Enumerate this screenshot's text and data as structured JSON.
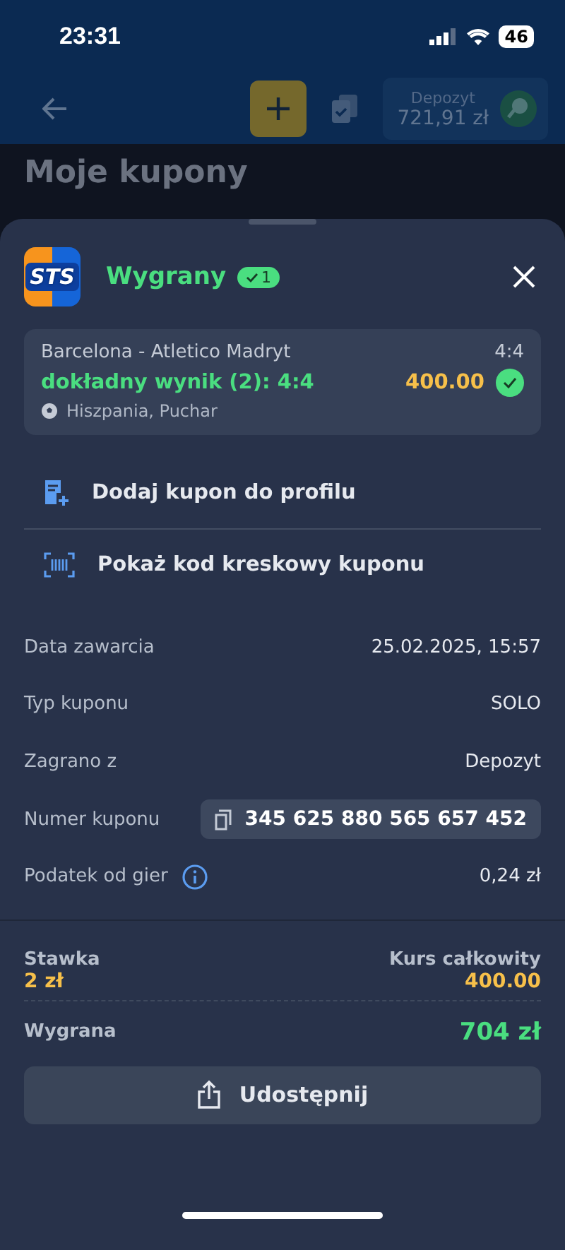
{
  "status_bar": {
    "time": "23:31",
    "battery": "46"
  },
  "header": {
    "balance_label": "Depozyt",
    "balance": "721,91 zł"
  },
  "page_title": "Moje kupony",
  "sheet": {
    "logo": "STS",
    "status": "Wygrany",
    "won_count": "1",
    "bet": {
      "match": "Barcelona - Atletico Madryt",
      "score": "4:4",
      "selection": "dokładny wynik (2): 4:4",
      "odds": "400.00",
      "won": true,
      "league": "Hiszpania, Puchar"
    },
    "actions": [
      {
        "kind": "add",
        "label": "Dodaj kupon do profilu"
      },
      {
        "kind": "barcode",
        "label": "Pokaż kod kreskowy kuponu"
      }
    ],
    "details": [
      {
        "kind": "text",
        "label": "Data zawarcia",
        "value": "25.02.2025, 15:57"
      },
      {
        "kind": "text",
        "label": "Typ kuponu",
        "value": "SOLO"
      },
      {
        "kind": "text",
        "label": "Zagrano z",
        "value": "Depozyt"
      },
      {
        "kind": "copy",
        "label": "Numer kuponu",
        "value": "345 625 880 565 657 452"
      },
      {
        "kind": "info",
        "label": "Podatek od gier",
        "value": "0,24 zł"
      }
    ],
    "summary": {
      "stake_label": "Stawka",
      "stake": "2 zł",
      "total_odds_label": "Kurs całkowity",
      "total_odds": "400.00",
      "win_label": "Wygrana",
      "win": "704 zł"
    },
    "share_button": "Udostępnij"
  }
}
